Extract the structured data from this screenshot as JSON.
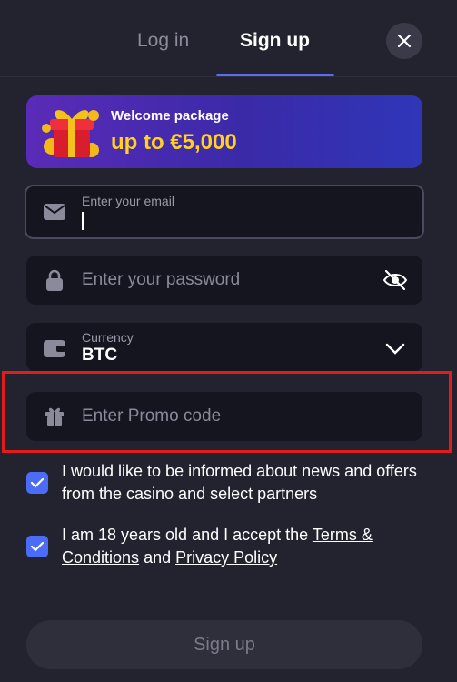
{
  "tabs": {
    "login": "Log in",
    "signup": "Sign up",
    "active": "signup"
  },
  "banner": {
    "subtitle": "Welcome package",
    "amount": "up to €5,000"
  },
  "email": {
    "placeholder": "Enter your email"
  },
  "password": {
    "placeholder": "Enter your password"
  },
  "currency": {
    "label": "Currency",
    "value": "BTC"
  },
  "promo": {
    "placeholder": "Enter Promo code"
  },
  "consent_news": {
    "checked": true,
    "text": "I would like to be informed about news and offers from the casino and select partners"
  },
  "consent_terms": {
    "checked": true,
    "text_before": "I am 18 years old and I accept the ",
    "terms_link": "Terms & Conditions",
    "text_middle": " and ",
    "privacy_link": "Privacy Policy"
  },
  "submit": {
    "label": "Sign up"
  },
  "colors": {
    "accent": "#5b6bf5",
    "checkbox": "#4a6cf7",
    "highlight": "#e01c1c",
    "banner_amount": "#ffd21f"
  },
  "icons": [
    "close-icon",
    "gift-box-icon",
    "envelope-icon",
    "lock-icon",
    "eye-off-icon",
    "wallet-icon",
    "chevron-down-icon",
    "gift-icon",
    "checkmark-icon"
  ]
}
